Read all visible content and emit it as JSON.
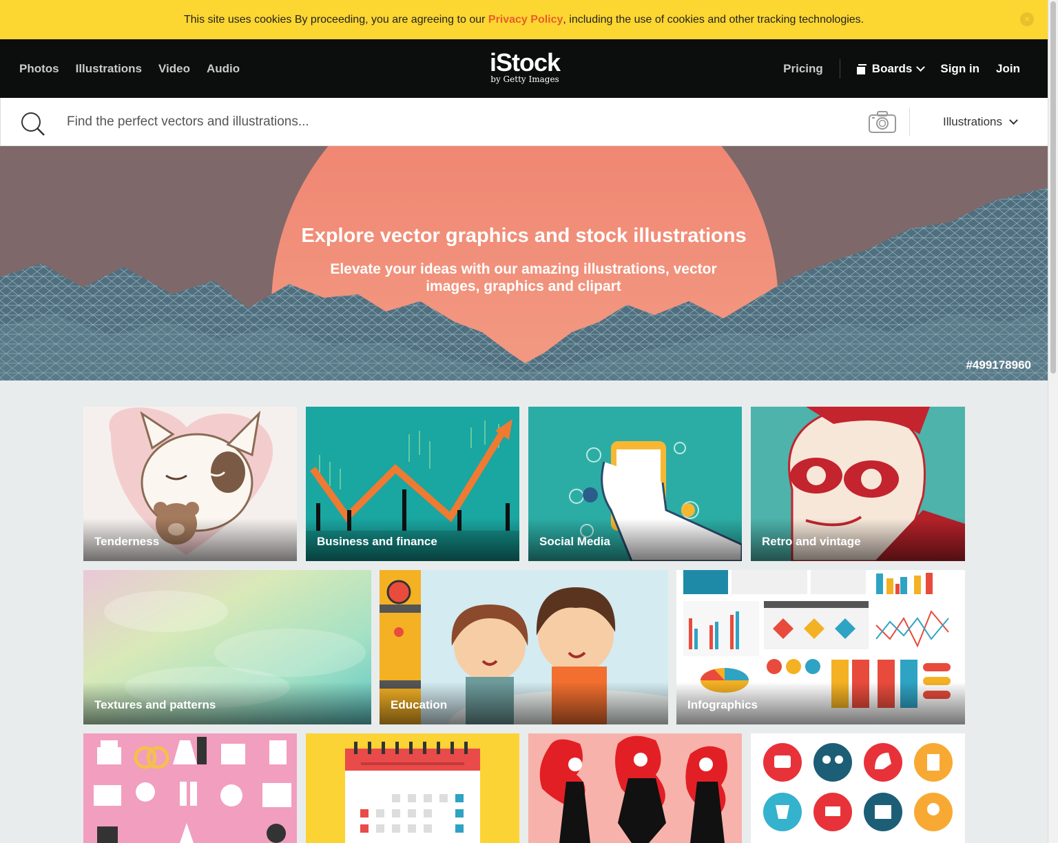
{
  "cookie": {
    "text_before": "This site uses cookies By proceeding, you are agreeing to our ",
    "link": "Privacy Policy",
    "text_after": ", including the use of cookies and other tracking technologies.",
    "close": "×"
  },
  "header": {
    "nav": [
      "Photos",
      "Illustrations",
      "Video",
      "Audio"
    ],
    "logo": "iStock",
    "logo_sub": "by Getty Images",
    "pricing": "Pricing",
    "boards": "Boards",
    "signin": "Sign in",
    "join": "Join"
  },
  "search": {
    "placeholder": "Find the perfect vectors and illustrations...",
    "type": "Illustrations"
  },
  "hero": {
    "title": "Explore vector graphics and stock illustrations",
    "subtitle": "Elevate your ideas with our amazing illustrations, vector images, graphics and clipart",
    "image_id": "#499178960"
  },
  "tiles": [
    "Tenderness",
    "Business and finance",
    "Social Media",
    "Retro and vintage",
    "Textures and patterns",
    "Education",
    "Infographics"
  ],
  "colors": {
    "cookie_bg": "#fcd631",
    "header_bg": "#0c0d0d",
    "link": "#e85d2c",
    "page_bg": "#e9ecec"
  }
}
